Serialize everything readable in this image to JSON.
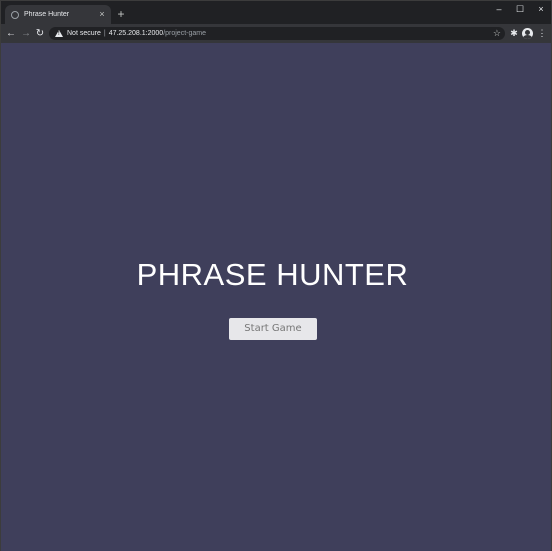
{
  "browser": {
    "tab": {
      "title": "Phrase Hunter",
      "close": "×"
    },
    "new_tab": "+",
    "window_controls": {
      "minimize": "–",
      "maximize": "☐",
      "close": "×"
    },
    "nav": {
      "back": "←",
      "forward": "→",
      "reload": "↻"
    },
    "address_bar": {
      "security_label": "Not secure",
      "separator": "|",
      "host": "47.25.208.1:2000",
      "path": "/project-game"
    },
    "icons": {
      "star": "☆",
      "extensions": "✱",
      "menu": "⋮"
    }
  },
  "page": {
    "background_color": "#3f3f5b",
    "title": "PHRASE HUNTER",
    "start_button_label": "Start Game"
  }
}
